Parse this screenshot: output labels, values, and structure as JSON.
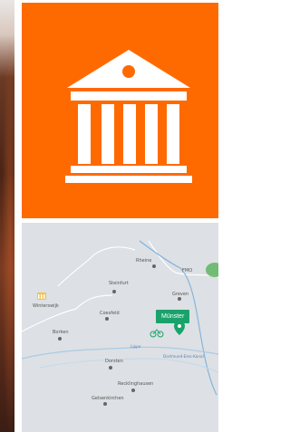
{
  "tiles": {
    "museum": {
      "icon": "museum-icon",
      "color": "#ff6a00"
    },
    "map": {
      "highlight": "Münster",
      "highlight_color": "#1aa26b",
      "cities": [
        "Rheine",
        "Steinfurt",
        "Greven",
        "Coesfeld",
        "Borken",
        "Dorsten",
        "Recklinghausen",
        "Gelsenkirchen"
      ],
      "map_region_label": "Winterswijk",
      "rivers": [
        "Lippe",
        "Dortmund-Ems-Kanal"
      ],
      "badges": [
        "FMO"
      ]
    }
  }
}
